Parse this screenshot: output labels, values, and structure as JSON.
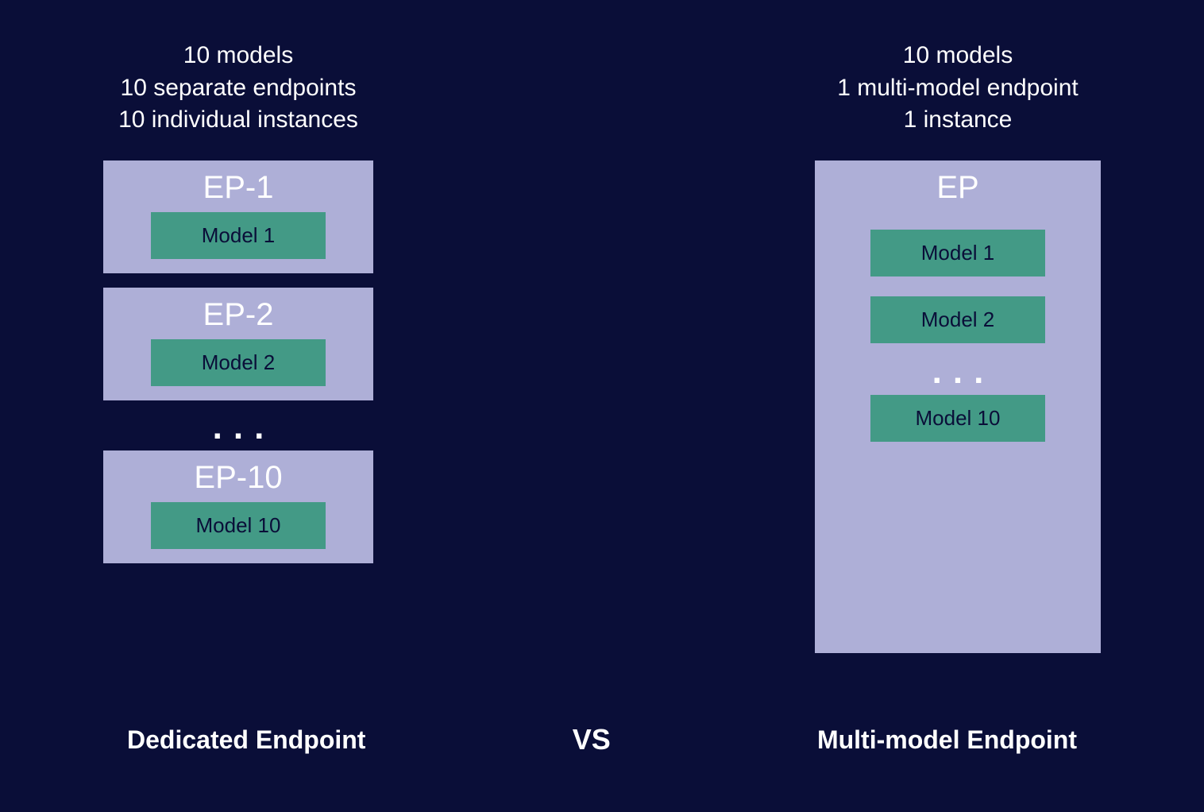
{
  "left": {
    "header_line1": "10 models",
    "header_line2": "10 separate endpoints",
    "header_line3": "10 individual instances",
    "ep1_title": "EP-1",
    "ep1_model": "Model 1",
    "ep2_title": "EP-2",
    "ep2_model": "Model 2",
    "ellipsis": "...",
    "ep10_title": "EP-10",
    "ep10_model": "Model 10",
    "label": "Dedicated Endpoint"
  },
  "right": {
    "header_line1": "10 models",
    "header_line2": "1 multi-model endpoint",
    "header_line3": "1 instance",
    "ep_title": "EP",
    "model1": "Model 1",
    "model2": "Model 2",
    "ellipsis": "...",
    "model10": "Model 10",
    "label": "Multi-model Endpoint"
  },
  "vs": "VS"
}
